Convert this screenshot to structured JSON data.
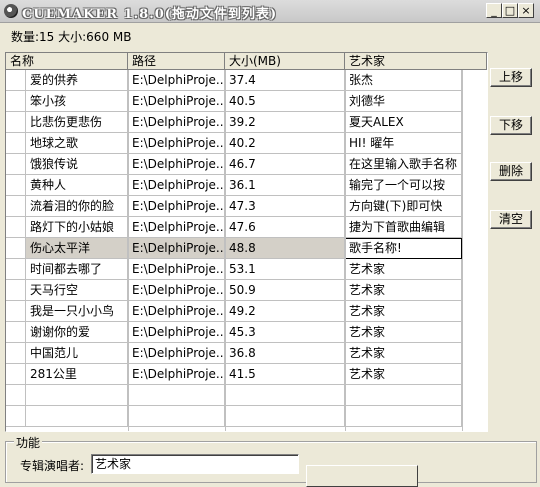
{
  "window": {
    "title": "CUEMAKER 1.8.0(拖动文件到列表)",
    "minimize": "_",
    "maximize": "□",
    "close": "×"
  },
  "summary": "数量:15 大小:660 MB",
  "table": {
    "columns": [
      "名称",
      "路径",
      "大小(MB)",
      "艺术家"
    ],
    "rows": [
      {
        "name": "爱的供养",
        "path": "E:\\DelphiProje...",
        "size": "37.4",
        "artist": "张杰"
      },
      {
        "name": "笨小孩",
        "path": "E:\\DelphiProje...",
        "size": "40.5",
        "artist": "刘德华"
      },
      {
        "name": "比悲伤更悲伤",
        "path": "E:\\DelphiProje...",
        "size": "39.2",
        "artist": "夏天ALEX"
      },
      {
        "name": "地球之歌",
        "path": "E:\\DelphiProje...",
        "size": "40.2",
        "artist": "HI! 曜年"
      },
      {
        "name": "饿狼传说",
        "path": "E:\\DelphiProje...",
        "size": "46.7",
        "artist": "在这里输入歌手名称"
      },
      {
        "name": "黄种人",
        "path": "E:\\DelphiProje...",
        "size": "36.1",
        "artist": "输完了一个可以按"
      },
      {
        "name": "流着泪的你的脸",
        "path": "E:\\DelphiProje...",
        "size": "47.3",
        "artist": "方向键(下)即可快"
      },
      {
        "name": "路灯下的小姑娘",
        "path": "E:\\DelphiProje...",
        "size": "47.6",
        "artist": "捷为下首歌曲编辑"
      },
      {
        "name": "伤心太平洋",
        "path": "E:\\DelphiProje...",
        "size": "48.8",
        "artist": "歌手名称!"
      },
      {
        "name": "时间都去哪了",
        "path": "E:\\DelphiProje...",
        "size": "53.1",
        "artist": "艺术家"
      },
      {
        "name": "天马行空",
        "path": "E:\\DelphiProje...",
        "size": "50.9",
        "artist": "艺术家"
      },
      {
        "name": "我是一只小小鸟",
        "path": "E:\\DelphiProje...",
        "size": "49.2",
        "artist": "艺术家"
      },
      {
        "name": "谢谢你的爱",
        "path": "E:\\DelphiProje...",
        "size": "45.3",
        "artist": "艺术家"
      },
      {
        "name": "中国范儿",
        "path": "E:\\DelphiProje...",
        "size": "36.8",
        "artist": "艺术家"
      },
      {
        "name": "281公里",
        "path": "E:\\DelphiProje...",
        "size": "41.5",
        "artist": "艺术家"
      }
    ],
    "selected_row": 8,
    "editor_value": "歌手名称!"
  },
  "buttons": {
    "move_up": "上移",
    "move_down": "下移",
    "delete": "删除",
    "clear": "清空"
  },
  "function_group": {
    "title": "功能",
    "album_artist_label": "专辑演唱者:",
    "album_artist_value": "艺术家"
  }
}
